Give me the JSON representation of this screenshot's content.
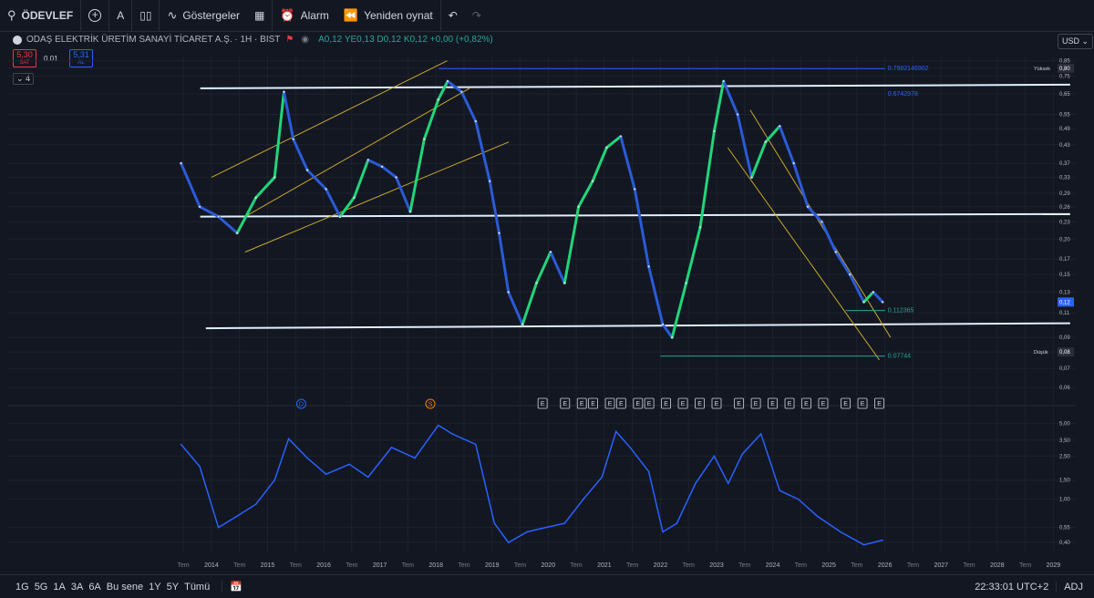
{
  "toolbar": {
    "symbol": "ÖDEVLEF",
    "interval": "A",
    "indicators": "Göstergeler",
    "alarm": "Alarm",
    "replay": "Yeniden oynat"
  },
  "legend": {
    "name": "ODAŞ ELEKTRİK ÜRETİM SANAYİ TİCARET A.Ş. · 1H · BIST",
    "ohlc": "A0,12 YE0,13 D0,12 K0,12 +0,00 (+0,82%)",
    "sell_price": "5,30",
    "sell_label": "SAT",
    "spread": "0.01",
    "buy_price": "5,31",
    "buy_label": "AL",
    "collapse_count": "4",
    "currency": "USD"
  },
  "bottom": {
    "ranges": [
      "1G",
      "5G",
      "1A",
      "3A",
      "6A",
      "Bu sene",
      "1Y",
      "5Y",
      "Tümü"
    ],
    "clock": "22:33:01 UTC+2",
    "adj": "ADJ"
  },
  "chart_data": {
    "type": "line",
    "price_axis_ticks": [
      "0,85",
      "0,80",
      "0,75",
      "0,65",
      "0,55",
      "0,49",
      "0,43",
      "0,37",
      "0,33",
      "0,29",
      "0,26",
      "0,23",
      "0,20",
      "0,17",
      "0,15",
      "0,13",
      "0,11",
      "0,09",
      "0,08",
      "0,07",
      "0,06"
    ],
    "indicator_axis_ticks": [
      "5,00",
      "3,50",
      "2,50",
      "1,50",
      "1,00",
      "0,55",
      "0,40"
    ],
    "x_ticks": [
      "Tem",
      "2014",
      "Tem",
      "2015",
      "Tem",
      "2016",
      "Tem",
      "2017",
      "Tem",
      "2018",
      "Tem",
      "2019",
      "Tem",
      "2020",
      "Tem",
      "2021",
      "Tem",
      "2022",
      "Tem",
      "2023",
      "Tem",
      "2024",
      "Tem",
      "2025",
      "Tem",
      "2026",
      "Tem",
      "2027",
      "Tem",
      "2028",
      "Tem",
      "2029"
    ],
    "annotations": {
      "fib_high": "0.7982146902",
      "fib_mid": "0.6742978",
      "fib_low1": "0.112365",
      "fib_low2": "0.07744",
      "high_label": "Yüksek",
      "high_value": "0,80",
      "low_label": "Düşük",
      "low_value": "0,08",
      "last_value": "0,12"
    },
    "price_series": {
      "name": "",
      "x": [
        "2013-06",
        "2013-10",
        "2014-02",
        "2014-06",
        "2014-10",
        "2015-02",
        "2015-04",
        "2015-06",
        "2015-09",
        "2016-01",
        "2016-04",
        "2016-07",
        "2016-10",
        "2017-01",
        "2017-04",
        "2017-07",
        "2017-10",
        "2018-01",
        "2018-03",
        "2018-06",
        "2018-09",
        "2018-12",
        "2019-02",
        "2019-04",
        "2019-07",
        "2019-10",
        "2020-01",
        "2020-04",
        "2020-07",
        "2020-10",
        "2021-01",
        "2021-04",
        "2021-07",
        "2021-10",
        "2022-01",
        "2022-03",
        "2022-06",
        "2022-09",
        "2022-12",
        "2023-02",
        "2023-05",
        "2023-08",
        "2023-11",
        "2024-02",
        "2024-05",
        "2024-08",
        "2024-11",
        "2025-02",
        "2025-05",
        "2025-08",
        "2025-10",
        "2025-12"
      ],
      "values": [
        0.37,
        0.26,
        0.24,
        0.21,
        0.28,
        0.33,
        0.66,
        0.45,
        0.35,
        0.3,
        0.24,
        0.28,
        0.38,
        0.36,
        0.33,
        0.25,
        0.45,
        0.62,
        0.72,
        0.66,
        0.52,
        0.32,
        0.21,
        0.13,
        0.1,
        0.14,
        0.18,
        0.14,
        0.26,
        0.32,
        0.42,
        0.46,
        0.3,
        0.16,
        0.1,
        0.09,
        0.14,
        0.22,
        0.48,
        0.72,
        0.55,
        0.33,
        0.44,
        0.5,
        0.37,
        0.26,
        0.23,
        0.18,
        0.15,
        0.12,
        0.13,
        0.12
      ]
    },
    "indicator_series": {
      "name": "",
      "x": [
        "2013-06",
        "2013-10",
        "2014-02",
        "2014-06",
        "2014-10",
        "2015-02",
        "2015-05",
        "2015-09",
        "2016-01",
        "2016-06",
        "2016-10",
        "2017-03",
        "2017-08",
        "2018-01",
        "2018-04",
        "2018-09",
        "2019-01",
        "2019-04",
        "2019-08",
        "2019-12",
        "2020-04",
        "2020-08",
        "2020-12",
        "2021-03",
        "2021-06",
        "2021-10",
        "2022-01",
        "2022-04",
        "2022-08",
        "2022-12",
        "2023-03",
        "2023-06",
        "2023-10",
        "2024-02",
        "2024-06",
        "2024-10",
        "2025-03",
        "2025-08",
        "2025-12"
      ],
      "values": [
        3.2,
        2.0,
        0.55,
        0.7,
        0.9,
        1.5,
        3.6,
        2.4,
        1.7,
        2.1,
        1.6,
        3.0,
        2.4,
        4.8,
        4.0,
        3.2,
        0.6,
        0.4,
        0.5,
        0.55,
        0.6,
        1.0,
        1.6,
        4.2,
        3.0,
        1.8,
        0.5,
        0.6,
        1.4,
        2.5,
        1.4,
        2.6,
        4.0,
        1.2,
        1.0,
        0.7,
        0.5,
        0.38,
        0.42
      ]
    },
    "events_label": "E",
    "markers": {
      "dividend": "D",
      "split": "S"
    }
  }
}
